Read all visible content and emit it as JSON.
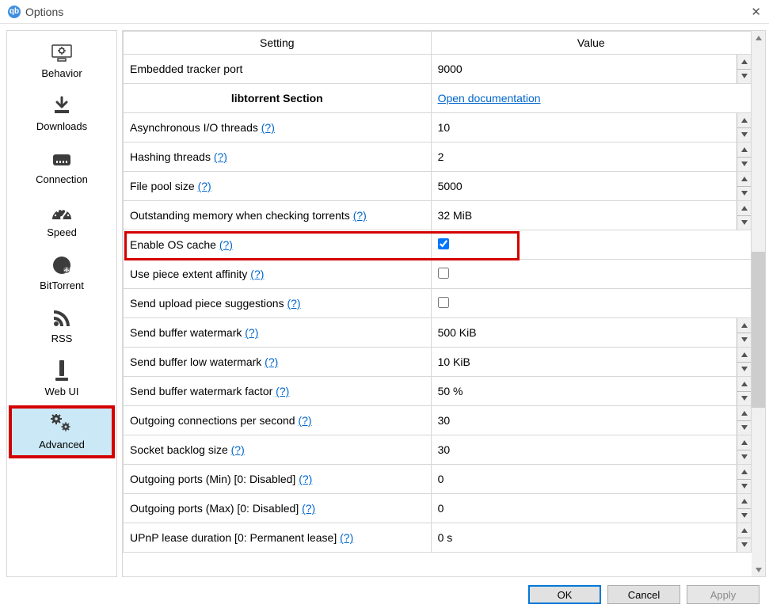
{
  "window": {
    "title": "Options"
  },
  "sidebar": {
    "items": [
      {
        "id": "behavior",
        "label": "Behavior"
      },
      {
        "id": "downloads",
        "label": "Downloads"
      },
      {
        "id": "connection",
        "label": "Connection"
      },
      {
        "id": "speed",
        "label": "Speed"
      },
      {
        "id": "bittorrent",
        "label": "BitTorrent"
      },
      {
        "id": "rss",
        "label": "RSS"
      },
      {
        "id": "webui",
        "label": "Web UI"
      },
      {
        "id": "advanced",
        "label": "Advanced",
        "selected": true,
        "highlight": true
      }
    ]
  },
  "table": {
    "headers": {
      "setting": "Setting",
      "value": "Value"
    },
    "section": {
      "label": "libtorrent Section",
      "doc_link": "Open documentation"
    },
    "help_token": "(?)",
    "rows": [
      {
        "label": "Embedded tracker port",
        "help": false,
        "type": "spin",
        "value": "9000"
      },
      {
        "label": "Asynchronous I/O threads",
        "help": true,
        "type": "spin",
        "value": "10"
      },
      {
        "label": "Hashing threads",
        "help": true,
        "type": "spin",
        "value": "2"
      },
      {
        "label": "File pool size",
        "help": true,
        "type": "spin",
        "value": "5000"
      },
      {
        "label": "Outstanding memory when checking torrents",
        "help": true,
        "type": "spin",
        "value": "32 MiB"
      },
      {
        "label": "Enable OS cache",
        "help": true,
        "type": "check",
        "checked": true,
        "highlight": true
      },
      {
        "label": "Use piece extent affinity",
        "help": true,
        "type": "check",
        "checked": false
      },
      {
        "label": "Send upload piece suggestions",
        "help": true,
        "type": "check",
        "checked": false
      },
      {
        "label": "Send buffer watermark",
        "help": true,
        "type": "spin",
        "value": "500 KiB"
      },
      {
        "label": "Send buffer low watermark",
        "help": true,
        "type": "spin",
        "value": "10 KiB"
      },
      {
        "label": "Send buffer watermark factor",
        "help": true,
        "type": "spin",
        "value": "50 %"
      },
      {
        "label": "Outgoing connections per second",
        "help": true,
        "type": "spin",
        "value": "30"
      },
      {
        "label": "Socket backlog size",
        "help": true,
        "type": "spin",
        "value": "30"
      },
      {
        "label": "Outgoing ports (Min) [0: Disabled]",
        "help": true,
        "type": "spin",
        "value": "0"
      },
      {
        "label": "Outgoing ports (Max) [0: Disabled]",
        "help": true,
        "type": "spin",
        "value": "0"
      },
      {
        "label": "UPnP lease duration [0: Permanent lease]",
        "help": true,
        "type": "spin",
        "value": "0 s"
      }
    ]
  },
  "footer": {
    "ok": "OK",
    "cancel": "Cancel",
    "apply": "Apply"
  },
  "icons": {
    "app": "qb"
  }
}
